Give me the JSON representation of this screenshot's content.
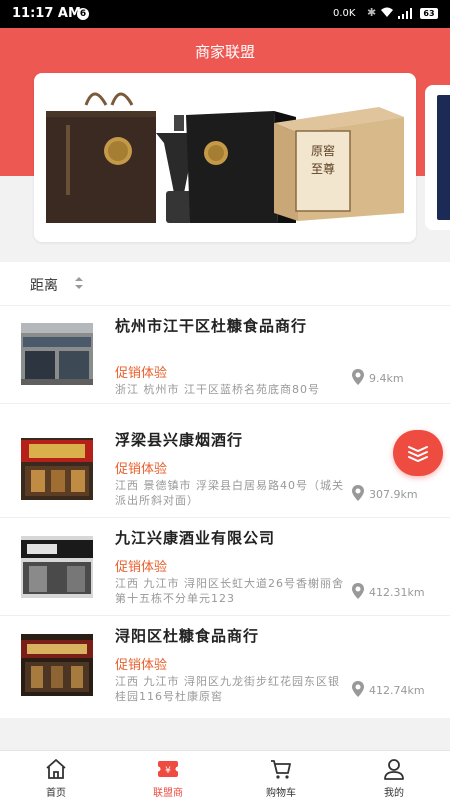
{
  "status_bar": {
    "time": "11:17 AM",
    "net_speed": "0.0K",
    "battery": "63"
  },
  "header": {
    "title": "商家联盟"
  },
  "sort": {
    "label": "距离"
  },
  "stores": [
    {
      "name": "杭州市江干区杜糠食品商行",
      "promo": "促销体验",
      "address": "浙江 杭州市 江干区蓝桥名苑底商80号",
      "distance": "9.4km"
    },
    {
      "name": "浮梁县兴康烟酒行",
      "promo": "促销体验",
      "address": "江西 景德镇市 浮梁县白居易路40号（城关派出所斜对面）",
      "distance": "307.9km"
    },
    {
      "name": "九江兴康酒业有限公司",
      "promo": "促销体验",
      "address": "江西 九江市 浔阳区长虹大道26号香榭丽舍第十五栋不分单元123",
      "distance": "412.31km"
    },
    {
      "name": "浔阳区杜糠食品商行",
      "promo": "促销体验",
      "address": "江西 九江市 浔阳区九龙街步红花园东区银桂园116号杜康原窖",
      "distance": "412.74km"
    }
  ],
  "tabs": [
    {
      "label": "首页"
    },
    {
      "label": "联盟商"
    },
    {
      "label": "购物车"
    },
    {
      "label": "我的"
    }
  ],
  "colors": {
    "brand_red": "#ee5853",
    "promo_orange": "#e8602c",
    "active_tab": "#ef4c41"
  }
}
